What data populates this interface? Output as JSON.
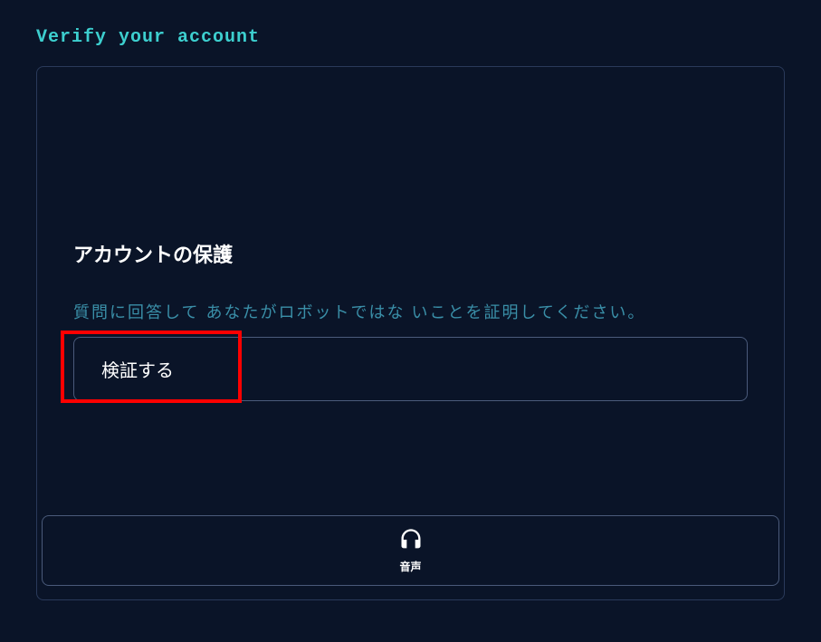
{
  "page": {
    "title": "Verify your account"
  },
  "captcha": {
    "heading": "アカウントの保護",
    "instruction": "質問に回答して あなたがロボットではな いことを証明してください。",
    "verify_button_label": "検証する",
    "audio_button_label": "音声"
  }
}
